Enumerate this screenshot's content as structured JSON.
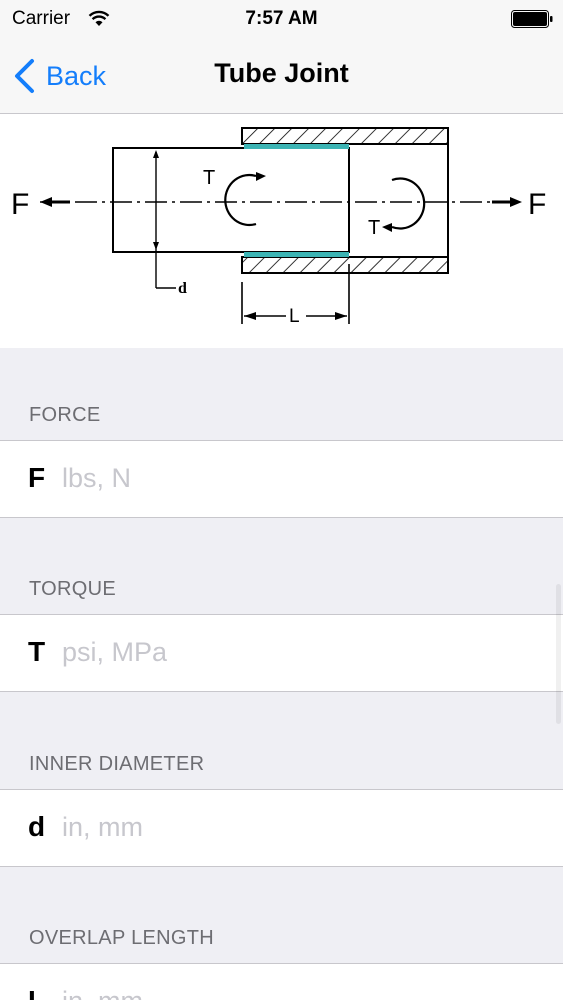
{
  "status_bar": {
    "carrier": "Carrier",
    "time": "7:57 AM"
  },
  "nav": {
    "back_label": "Back",
    "title": "Tube Joint"
  },
  "diagram": {
    "labels": {
      "force_left": "F",
      "force_right": "F",
      "torque_left": "T",
      "torque_right": "T",
      "diameter": "d",
      "length": "L"
    }
  },
  "sections": [
    {
      "header": "FORCE",
      "symbol": "F",
      "placeholder": "lbs, N",
      "value": ""
    },
    {
      "header": "TORQUE",
      "symbol": "T",
      "placeholder": "psi, MPa",
      "value": ""
    },
    {
      "header": "INNER DIAMETER",
      "symbol": "d",
      "placeholder": "in, mm",
      "value": ""
    },
    {
      "header": "OVERLAP LENGTH",
      "symbol": "L",
      "placeholder": "in, mm",
      "value": ""
    }
  ],
  "colors": {
    "accent": "#147efb",
    "adhesive": "#3cb4b4",
    "header_text": "#6d6d72",
    "placeholder": "#c7c7cd"
  }
}
